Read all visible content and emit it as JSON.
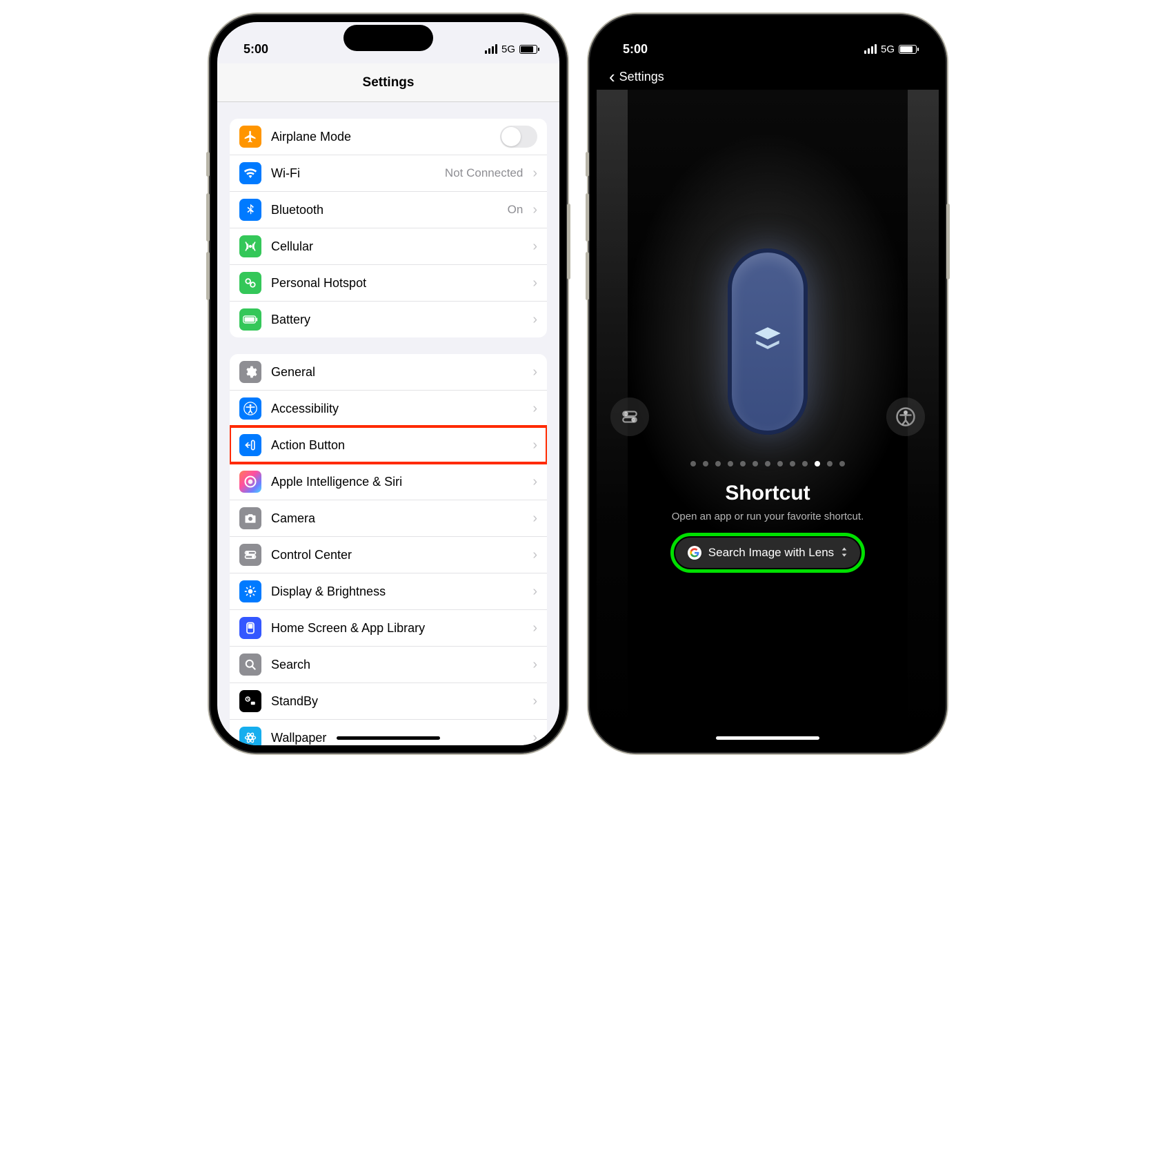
{
  "status": {
    "time": "5:00",
    "network": "5G"
  },
  "left_screen": {
    "header_title": "Settings",
    "groups": [
      {
        "rows": [
          {
            "icon": "airplane-icon",
            "icon_bg": "#ff9500",
            "label": "Airplane Mode",
            "type": "toggle",
            "toggle_on": false
          },
          {
            "icon": "wifi-icon",
            "icon_bg": "#007aff",
            "label": "Wi-Fi",
            "value": "Not Connected",
            "type": "chevron"
          },
          {
            "icon": "bluetooth-icon",
            "icon_bg": "#007aff",
            "label": "Bluetooth",
            "value": "On",
            "type": "chevron"
          },
          {
            "icon": "cellular-icon",
            "icon_bg": "#34c759",
            "label": "Cellular",
            "type": "chevron"
          },
          {
            "icon": "hotspot-icon",
            "icon_bg": "#34c759",
            "label": "Personal Hotspot",
            "type": "chevron"
          },
          {
            "icon": "battery-icon",
            "icon_bg": "#34c759",
            "label": "Battery",
            "type": "chevron"
          }
        ]
      },
      {
        "rows": [
          {
            "icon": "gear-icon",
            "icon_bg": "#8e8e93",
            "label": "General",
            "type": "chevron"
          },
          {
            "icon": "accessibility-icon",
            "icon_bg": "#007aff",
            "label": "Accessibility",
            "type": "chevron"
          },
          {
            "icon": "action-button-icon",
            "icon_bg": "#007aff",
            "label": "Action Button",
            "type": "chevron",
            "highlight": true
          },
          {
            "icon": "siri-icon",
            "icon_bg": "siri",
            "label": "Apple Intelligence & Siri",
            "type": "chevron"
          },
          {
            "icon": "camera-icon",
            "icon_bg": "#8e8e93",
            "label": "Camera",
            "type": "chevron"
          },
          {
            "icon": "control-center-icon",
            "icon_bg": "#8e8e93",
            "label": "Control Center",
            "type": "chevron"
          },
          {
            "icon": "display-icon",
            "icon_bg": "#007aff",
            "label": "Display & Brightness",
            "type": "chevron"
          },
          {
            "icon": "home-screen-icon",
            "icon_bg": "#3457ff",
            "label": "Home Screen & App Library",
            "type": "chevron"
          },
          {
            "icon": "search-icon",
            "icon_bg": "#8e8e93",
            "label": "Search",
            "type": "chevron"
          },
          {
            "icon": "standby-icon",
            "icon_bg": "#000000",
            "label": "StandBy",
            "type": "chevron"
          },
          {
            "icon": "wallpaper-icon",
            "icon_bg": "#16aeee",
            "label": "Wallpaper",
            "type": "chevron"
          }
        ]
      }
    ]
  },
  "right_screen": {
    "back_label": "Settings",
    "page_dots_total": 13,
    "page_dots_active_index": 10,
    "title": "Shortcut",
    "description": "Open an app or run your favorite shortcut.",
    "selected_shortcut": "Search Image with Lens",
    "side_icons": {
      "left": "toggle-icon",
      "right": "accessibility-ring-icon"
    },
    "center_icon": "shortcut-stack-icon"
  },
  "highlight_colors": {
    "red_box": "#ff2a00",
    "green_box": "#00e000"
  }
}
